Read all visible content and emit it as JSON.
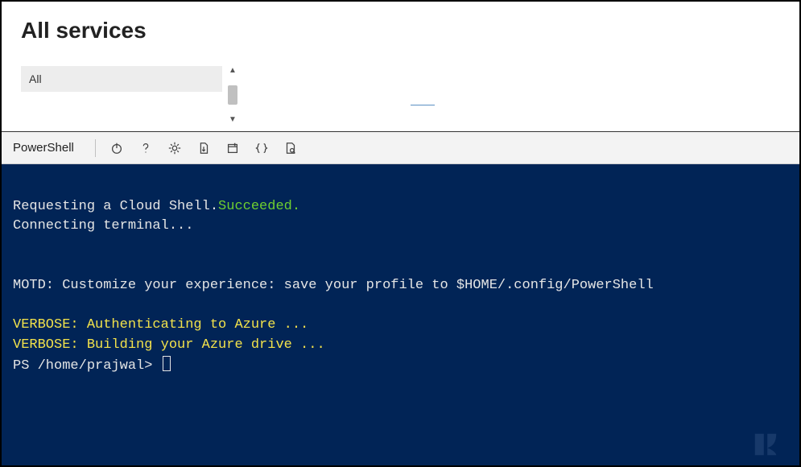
{
  "header": {
    "title": "All services",
    "filter_value": "All"
  },
  "toolbar": {
    "shell_label": "PowerShell"
  },
  "terminal": {
    "line1a": "Requesting a Cloud Shell.",
    "line1b": "Succeeded.",
    "line2": "Connecting terminal...",
    "motd": "MOTD: Customize your experience: save your profile to $HOME/.config/PowerShell",
    "verbose1": "VERBOSE: Authenticating to Azure ...",
    "verbose2": "VERBOSE: Building your Azure drive ...",
    "prompt": "PS /home/prajwal>"
  }
}
